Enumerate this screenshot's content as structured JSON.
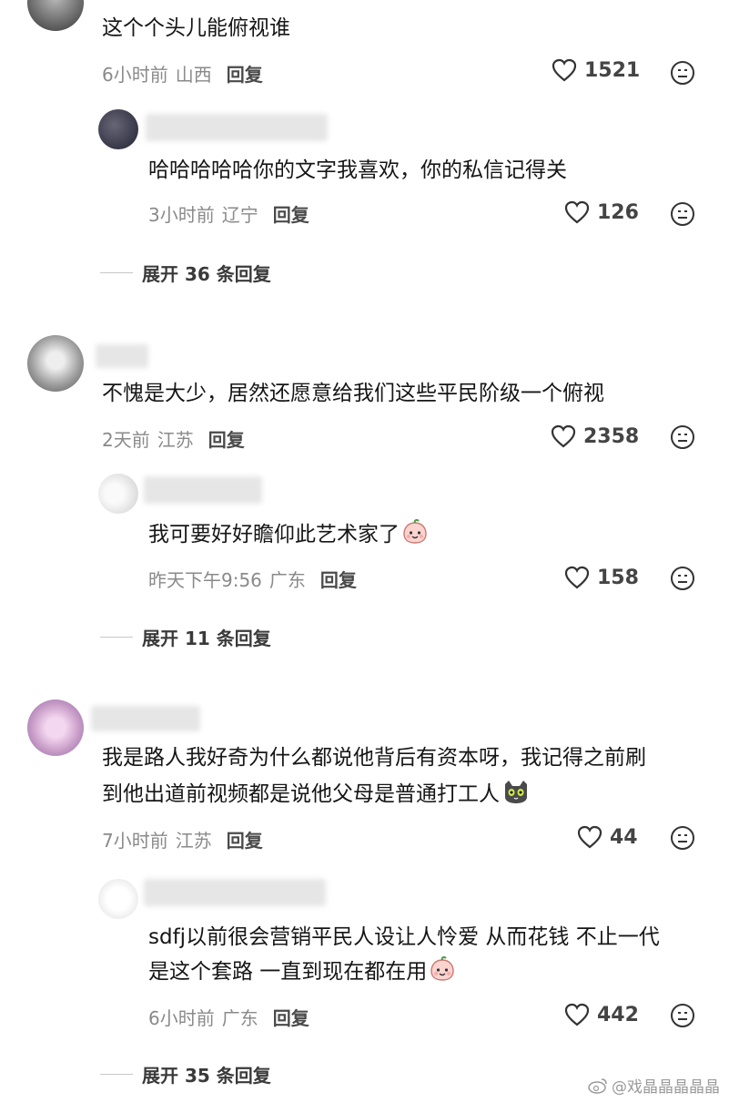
{
  "comments": [
    {
      "text": "这个个头儿能俯视谁",
      "time": "6小时前",
      "location": "山西",
      "reply": "回复",
      "likes": "1521",
      "sub": {
        "text": "哈哈哈哈哈你的文字我喜欢，你的私信记得关",
        "time": "3小时前",
        "location": "辽宁",
        "reply": "回复",
        "likes": "126"
      },
      "expand": "展开 36 条回复"
    },
    {
      "text": "不愧是大少，居然还愿意给我们这些平民阶级一个俯视",
      "time": "2天前",
      "location": "江苏",
      "reply": "回复",
      "likes": "2358",
      "sub": {
        "text": "我可要好好瞻仰此艺术家了",
        "time": "昨天下午9:56",
        "location": "广东",
        "reply": "回复",
        "likes": "158"
      },
      "expand": "展开 11 条回复"
    },
    {
      "text_line1": "我是路人我好奇为什么都说他背后有资本呀，我记得之前刷",
      "text_line2": "到他出道前视频都是说他父母是普通打工人",
      "time": "7小时前",
      "location": "江苏",
      "reply": "回复",
      "likes": "44",
      "sub": {
        "text_line1": "sdfj以前很会营销平民人设让人怜爱 从而花钱 不止一代",
        "text_line2": "是这个套路 一直到现在都在用",
        "time": "6小时前",
        "location": "广东",
        "reply": "回复",
        "likes": "442"
      },
      "expand": "展开 35 条回复"
    }
  ],
  "watermark": "@戏晶晶晶晶晶",
  "icons": {
    "like": "heart-outline-icon",
    "emoji": "face-icon",
    "sticker": "peach-face-sticker",
    "cat": "cat-face-sticker"
  }
}
